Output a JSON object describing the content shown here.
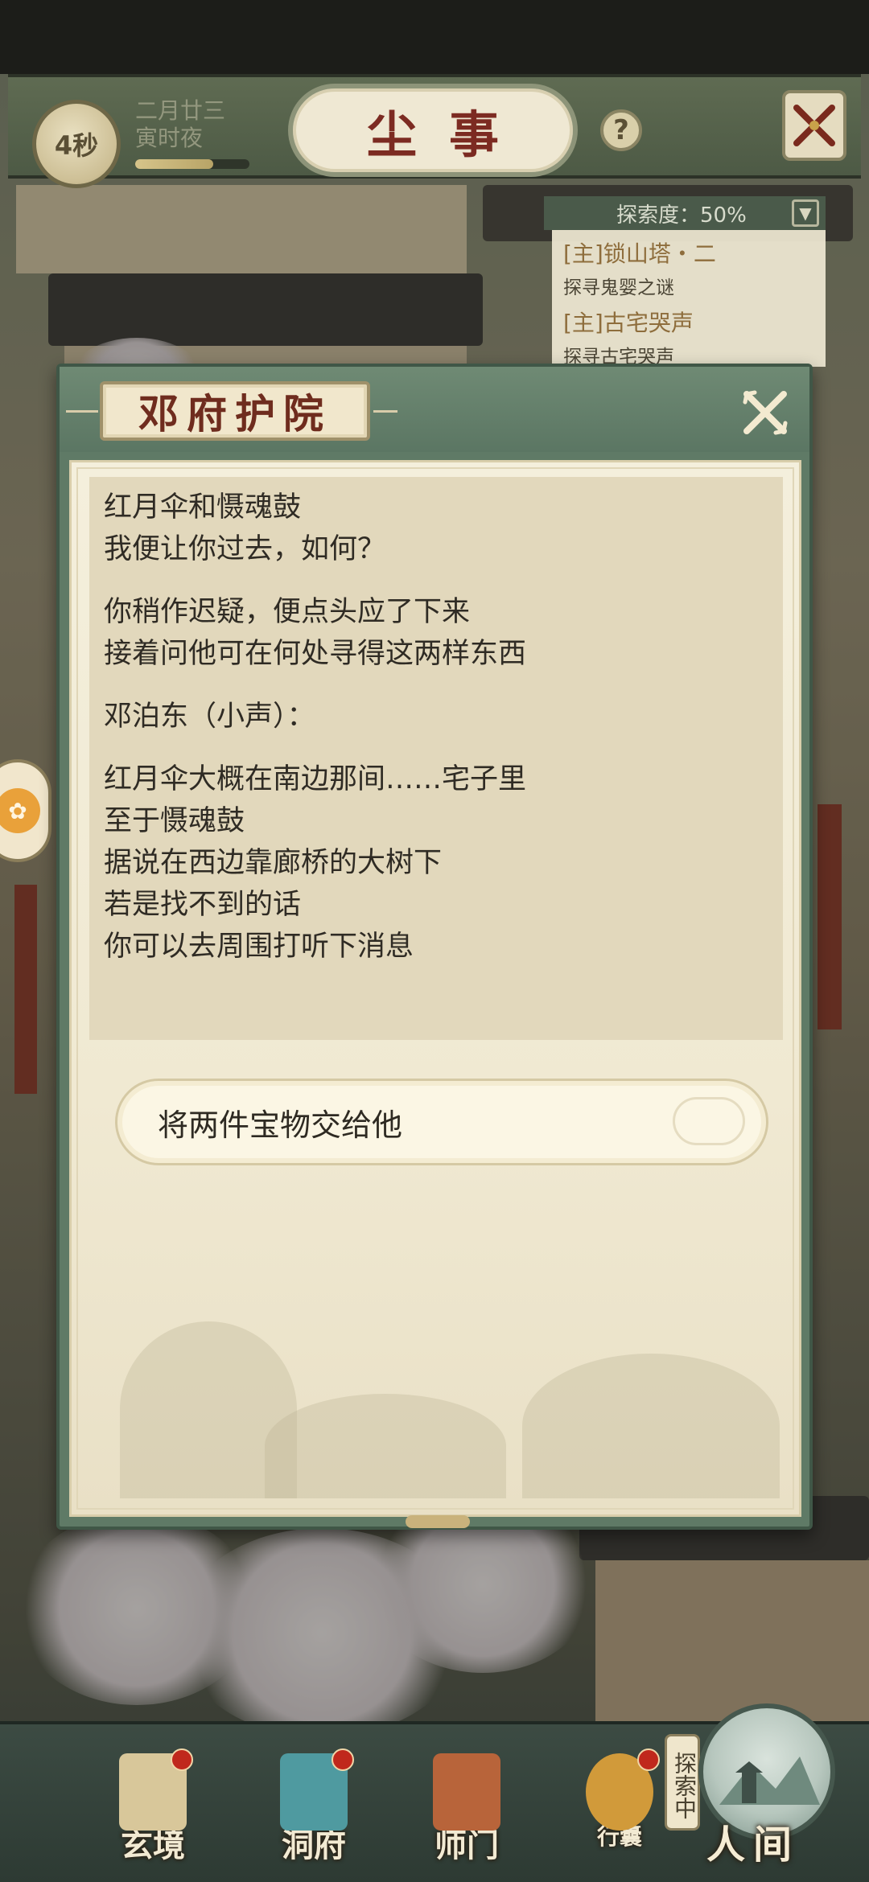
{
  "hud": {
    "timer": "4秒",
    "date": "二月廿三",
    "period": "寅时夜",
    "progress": 0.68,
    "title": "尘事",
    "help": "?"
  },
  "explore": {
    "label": "探索度：50%",
    "quests": [
      {
        "title": "[主]锁山塔・二",
        "desc": "探寻鬼婴之谜"
      },
      {
        "title": "[主]古宅哭声",
        "desc": "探寻古宅哭声"
      }
    ]
  },
  "dialog": {
    "title": "邓府护院",
    "paragraphs": [
      [
        "红月伞和慑魂鼓",
        "我便让你过去，如何？"
      ],
      [
        "你稍作迟疑，便点头应了下来",
        "接着问他可在何处寻得这两样东西"
      ],
      [
        "邓泊东（小声）："
      ],
      [
        "红月伞大概在南边那间……宅子里",
        "至于慑魂鼓",
        "据说在西边靠廊桥的大树下",
        "若是找不到的话",
        "你可以去周围打听下消息"
      ]
    ],
    "choice": "将两件宝物交给他"
  },
  "nav": {
    "items": [
      {
        "label": "玄境",
        "icon": "scroll-icon",
        "color": "#d8c79a",
        "badge": true
      },
      {
        "label": "洞府",
        "icon": "pavilion-icon",
        "color": "#4f9aa0",
        "badge": true
      },
      {
        "label": "师门",
        "icon": "banner-icon",
        "color": "#b8643a",
        "badge": false
      },
      {
        "label": "行囊",
        "icon": "bag-icon",
        "color": "#d19a3a",
        "badge": true
      }
    ],
    "explore_tag": "探索中",
    "world": "人间"
  }
}
